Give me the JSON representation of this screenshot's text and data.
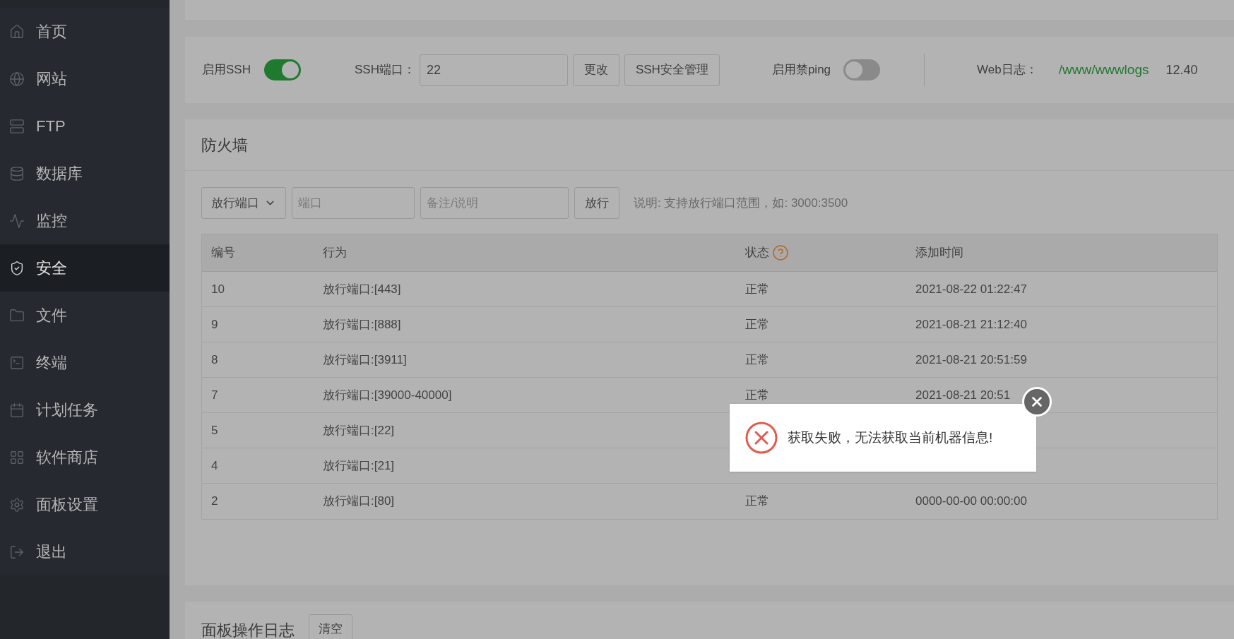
{
  "sidebar": {
    "items": [
      {
        "label": "首页",
        "selected": false
      },
      {
        "label": "网站",
        "selected": false
      },
      {
        "label": "FTP",
        "selected": false
      },
      {
        "label": "数据库",
        "selected": false
      },
      {
        "label": "监控",
        "selected": false
      },
      {
        "label": "安全",
        "selected": true
      },
      {
        "label": "文件",
        "selected": false
      },
      {
        "label": "终端",
        "selected": false
      },
      {
        "label": "计划任务",
        "selected": false
      },
      {
        "label": "软件商店",
        "selected": false
      },
      {
        "label": "面板设置",
        "selected": false
      },
      {
        "label": "退出",
        "selected": false
      }
    ]
  },
  "ssh_bar": {
    "ssh_toggle": {
      "label": "启用SSH",
      "on": true
    },
    "ssh_port": {
      "label": "SSH端口：",
      "value": "22"
    },
    "buttons": [
      "更改",
      "SSH安全管理"
    ],
    "ping_toggle": {
      "label": "启用禁ping",
      "on": false
    },
    "web_log": {
      "label": "Web日志：",
      "path": "/www/wwwlogs",
      "size": "12.40"
    }
  },
  "firewall": {
    "title": "防火墙",
    "toolbar": {
      "select": "放行端口",
      "port_placeholder": "端口",
      "note_placeholder": "备注/说明",
      "button": "放行",
      "hint": "说明: 支持放行端口范围，如: 3000:3500"
    },
    "table": {
      "columns": [
        "编号",
        "行为",
        "状态",
        "添加时间"
      ],
      "rows": [
        {
          "id": "10",
          "action": "放行端口:[443]",
          "status": "正常",
          "time": "2021-08-22 01:22:47"
        },
        {
          "id": "9",
          "action": "放行端口:[888]",
          "status": "正常",
          "time": "2021-08-21 21:12:40"
        },
        {
          "id": "8",
          "action": "放行端口:[3911]",
          "status": "正常",
          "time": "2021-08-21 20:51:59"
        },
        {
          "id": "7",
          "action": "放行端口:[39000-40000]",
          "status": "正常",
          "time": "2021-08-21 20:51"
        },
        {
          "id": "5",
          "action": "放行端口:[22]"
        },
        {
          "id": "4",
          "action": "放行端口:[21]"
        },
        {
          "id": "2",
          "action": "放行端口:[80]",
          "status": "正常",
          "time": "0000-00-00 00:00:00"
        }
      ]
    }
  },
  "dialog": {
    "message": "获取失败，无法获取当前机器信息!"
  },
  "log_panel": {
    "title": "面板操作日志",
    "button": "清空"
  }
}
